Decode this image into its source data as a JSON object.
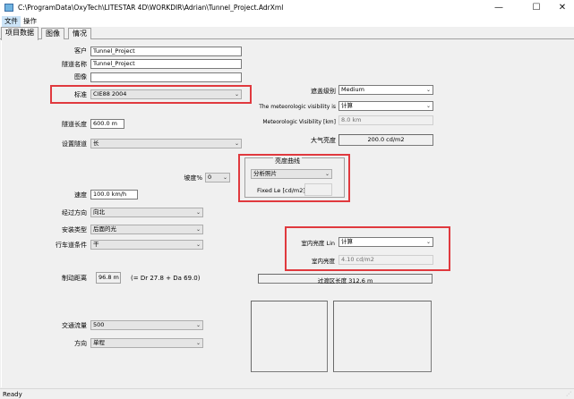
{
  "window": {
    "title": "C:\\ProgramData\\OxyTech\\LITESTAR 4D\\WORKDIR\\Adrian\\Tunnel_Project.AdrXml",
    "minimize": "—",
    "maximize": "☐",
    "close": "✕"
  },
  "menu": {
    "file": "文件",
    "operate": "操作"
  },
  "tabs": {
    "project": "项目数据",
    "image": "图像",
    "situation": "情况"
  },
  "form": {
    "client_label": "客户",
    "client_value": "Tunnel_Project",
    "tunnel_name_label": "隧道名称",
    "tunnel_name_value": "Tunnel_Project",
    "image_label": "图像",
    "standard_label": "标准",
    "standard_value": "CIE88 2004",
    "tunnel_length_label": "隧道长度",
    "tunnel_length_value": "600.0 m",
    "setup_label": "设置隧道",
    "setup_value": "长",
    "slope_label": "坡度%",
    "slope_value": "0",
    "speed_label": "速度",
    "speed_value": "100.0 km/h",
    "direction_label": "经过方向",
    "direction_value": "向北",
    "install_type_label": "安装类型",
    "install_type_value": "后面的光",
    "lane_condition_label": "行车道条件",
    "lane_condition_value": "干",
    "braking_label": "制动距离",
    "braking_value": "96.8 m",
    "braking_formula": "(= Dr 27.8 + Da 69.0)",
    "traffic_label": "交通流量",
    "traffic_value": "500",
    "orientation_label": "方向",
    "orientation_value": "单程",
    "occlusion_label": "遮盖级别",
    "occlusion_value": "Medium",
    "met_visibility_label": "The meteorologic visibility is",
    "met_visibility_value": "计算",
    "met_visibility_km_label": "Meteorologic Visibility [km]",
    "met_visibility_km_value": "8.0 km",
    "atmos_luminance_label": "大气亮度",
    "atmos_luminance_value": "200.0 cd/m2",
    "curve_title": "亮度曲线",
    "curve_value": "分析照片",
    "fixed_le_label": "Fixed Le [cd/m2]",
    "fixed_le_value": "",
    "interior_lum_lin_label": "室内亮度 Lin",
    "interior_lum_lin_value": "计算",
    "interior_lum_label": "室内亮度",
    "interior_lum_value": "4.10 cd/m2",
    "transition_label": "过渡区长度 312.6 m"
  },
  "status": {
    "text": "Ready"
  },
  "colors": {
    "highlight": "#e0393e",
    "window_bg": "#f0f0f0"
  }
}
